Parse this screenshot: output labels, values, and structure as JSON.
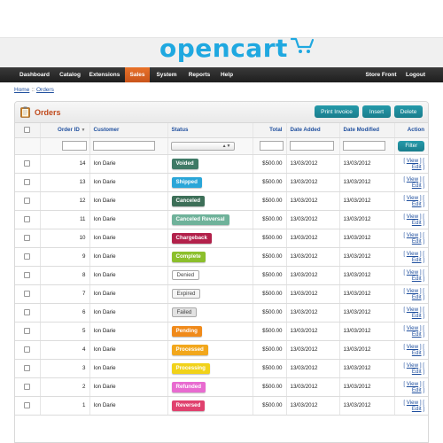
{
  "brand": {
    "logo_text": "opencart",
    "logo_color": "#1fa8e0"
  },
  "nav": {
    "left": [
      {
        "label": "Dashboard",
        "active": false
      },
      {
        "label": "Catalog",
        "active": false
      },
      {
        "label": "Extensions",
        "active": false
      },
      {
        "label": "Sales",
        "active": true
      },
      {
        "label": "System",
        "active": false
      },
      {
        "label": "Reports",
        "active": false
      },
      {
        "label": "Help",
        "active": false
      }
    ],
    "right": [
      {
        "label": "Store Front"
      },
      {
        "label": "Logout"
      }
    ]
  },
  "breadcrumb": {
    "home": "Home",
    "separator": "::",
    "current": "Orders"
  },
  "page": {
    "title": "Orders",
    "buttons": {
      "print": "Print Invoice",
      "insert": "Insert",
      "delete": "Delete"
    }
  },
  "table": {
    "columns": {
      "order_id": "Order ID",
      "customer": "Customer",
      "status": "Status",
      "total": "Total",
      "date_added": "Date Added",
      "date_modified": "Date Modified",
      "action": "Action"
    },
    "filter_button": "Filter",
    "action_view": "View",
    "action_edit": "Edit",
    "rows": [
      {
        "id": "14",
        "customer": "Ion Darie",
        "status": "Voided",
        "color": "#3f7a66",
        "style": "solid",
        "total": "$500.00",
        "added": "13/03/2012",
        "modified": "13/03/2012"
      },
      {
        "id": "13",
        "customer": "Ion Darie",
        "status": "Shipped",
        "color": "#2aa6d8",
        "style": "solid",
        "total": "$500.00",
        "added": "13/03/2012",
        "modified": "13/03/2012"
      },
      {
        "id": "12",
        "customer": "Ion Darie",
        "status": "Canceled",
        "color": "#3d6f58",
        "style": "solid",
        "total": "$500.00",
        "added": "13/03/2012",
        "modified": "13/03/2012"
      },
      {
        "id": "11",
        "customer": "Ion Darie",
        "status": "Canceled Reversal",
        "color": "#6fb29a",
        "style": "solid",
        "total": "$500.00",
        "added": "13/03/2012",
        "modified": "13/03/2012"
      },
      {
        "id": "10",
        "customer": "Ion Darie",
        "status": "Chargeback",
        "color": "#b2204a",
        "style": "solid",
        "total": "$500.00",
        "added": "13/03/2012",
        "modified": "13/03/2012"
      },
      {
        "id": "9",
        "customer": "Ion Darie",
        "status": "Complete",
        "color": "#8cbf2c",
        "style": "solid",
        "total": "$500.00",
        "added": "13/03/2012",
        "modified": "13/03/2012"
      },
      {
        "id": "8",
        "customer": "Ion Darie",
        "status": "Denied",
        "color": "#ffffff",
        "style": "light",
        "total": "$500.00",
        "added": "13/03/2012",
        "modified": "13/03/2012"
      },
      {
        "id": "7",
        "customer": "Ion Darie",
        "status": "Expired",
        "color": "#f4f4f4",
        "style": "light",
        "total": "$500.00",
        "added": "13/03/2012",
        "modified": "13/03/2012"
      },
      {
        "id": "6",
        "customer": "Ion Darie",
        "status": "Failed",
        "color": "#e2e2e2",
        "style": "light",
        "total": "$500.00",
        "added": "13/03/2012",
        "modified": "13/03/2012"
      },
      {
        "id": "5",
        "customer": "Ion Darie",
        "status": "Pending",
        "color": "#f08a1a",
        "style": "solid",
        "total": "$500.00",
        "added": "13/03/2012",
        "modified": "13/03/2012"
      },
      {
        "id": "4",
        "customer": "Ion Darie",
        "status": "Processed",
        "color": "#f2a71c",
        "style": "solid",
        "total": "$500.00",
        "added": "13/03/2012",
        "modified": "13/03/2012"
      },
      {
        "id": "3",
        "customer": "Ion Darie",
        "status": "Processing",
        "color": "#f1d21a",
        "style": "solid",
        "total": "$500.00",
        "added": "13/03/2012",
        "modified": "13/03/2012"
      },
      {
        "id": "2",
        "customer": "Ion Darie",
        "status": "Refunded",
        "color": "#e86bd0",
        "style": "solid",
        "total": "$500.00",
        "added": "13/03/2012",
        "modified": "13/03/2012"
      },
      {
        "id": "1",
        "customer": "Ion Darie",
        "status": "Reversed",
        "color": "#e0416e",
        "style": "solid",
        "total": "$500.00",
        "added": "13/03/2012",
        "modified": "13/03/2012"
      }
    ]
  },
  "colors": {
    "accent_nav": "#e8722a",
    "button": "#1f8c9b",
    "title": "#c04a1c",
    "link": "#1f4f9e"
  }
}
